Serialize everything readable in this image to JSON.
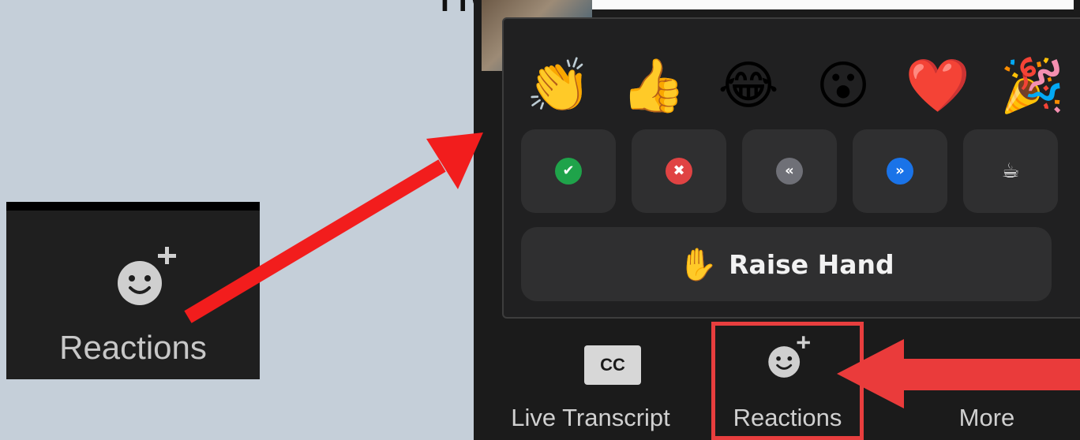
{
  "top_title": "ng          p",
  "left_button": {
    "label": "Reactions",
    "icon": "smiley-plus-icon"
  },
  "emojis": [
    "👏",
    "👍",
    "😂",
    "😮",
    "❤️",
    "🎉"
  ],
  "feedback": [
    {
      "name": "yes",
      "glyph": "✔",
      "color": "#1fa34a"
    },
    {
      "name": "no",
      "glyph": "✖",
      "color": "#e04343"
    },
    {
      "name": "slower",
      "glyph": "«",
      "color": "#6f7077"
    },
    {
      "name": "faster",
      "glyph": "»",
      "color": "#1a73e8"
    },
    {
      "name": "coffee",
      "glyph": "☕",
      "color": "#2f2f30"
    }
  ],
  "raise_hand": {
    "label": "Raise Hand",
    "icon": "✋"
  },
  "toolbar": {
    "cc_text": "CC",
    "live_transcript": "Live Transcript",
    "reactions": "Reactions",
    "more": "More",
    "more_dots": "• • •"
  },
  "colors": {
    "arrow": "#f21d1d",
    "highlight": "#e83e3e"
  }
}
